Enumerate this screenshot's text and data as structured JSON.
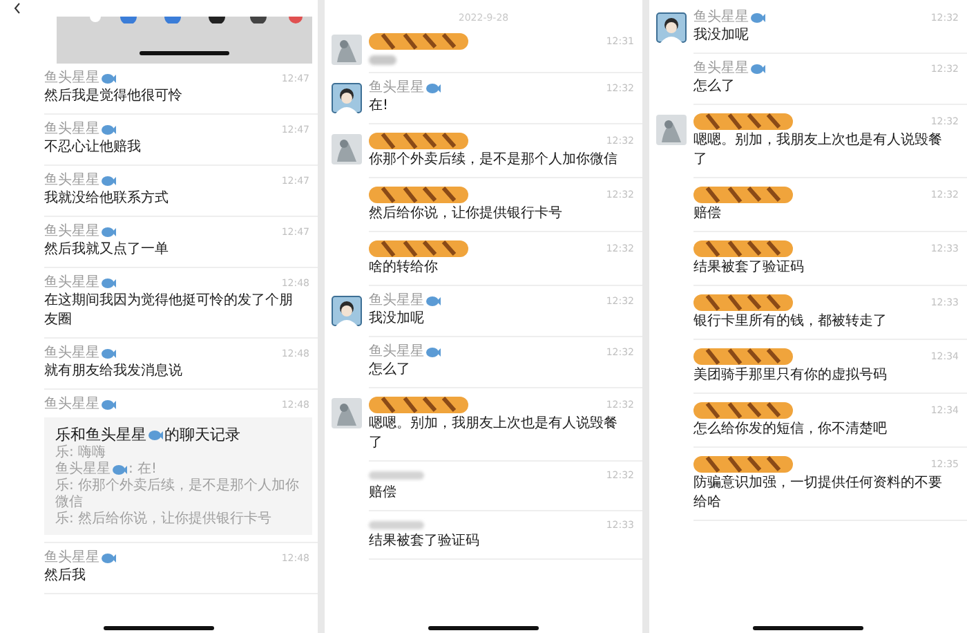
{
  "panels": [
    {
      "header": {
        "kind": "share-strip"
      },
      "messages": [
        {
          "sender": {
            "kind": "name",
            "text": "鱼头星星"
          },
          "time": "12:47",
          "body": {
            "kind": "text",
            "text": "然后我是觉得他很可怜"
          }
        },
        {
          "sender": {
            "kind": "name",
            "text": "鱼头星星"
          },
          "time": "12:47",
          "body": {
            "kind": "text",
            "text": "不忍心让他赔我"
          }
        },
        {
          "sender": {
            "kind": "name",
            "text": "鱼头星星"
          },
          "time": "12:47",
          "body": {
            "kind": "text",
            "text": "我就没给他联系方式"
          }
        },
        {
          "sender": {
            "kind": "name",
            "text": "鱼头星星"
          },
          "time": "12:47",
          "body": {
            "kind": "text",
            "text": "然后我就又点了一单"
          }
        },
        {
          "sender": {
            "kind": "name",
            "text": "鱼头星星"
          },
          "time": "12:48",
          "body": {
            "kind": "text",
            "text": "在这期间我因为觉得他挺可怜的发了个朋友圈"
          }
        },
        {
          "sender": {
            "kind": "name",
            "text": "鱼头星星"
          },
          "time": "12:48",
          "body": {
            "kind": "text",
            "text": "就有朋友给我发消息说"
          }
        },
        {
          "sender": {
            "kind": "name",
            "text": "鱼头星星"
          },
          "time": "12:48",
          "body": {
            "kind": "forward",
            "title_parts": [
              "乐和鱼头星星",
              "的聊天记录"
            ],
            "lines": [
              {
                "parts": [
                  "乐: 嗨嗨"
                ]
              },
              {
                "parts": [
                  "鱼头星星",
                  ": 在!"
                ]
              },
              {
                "parts": [
                  "乐: 你那个外卖后续，是不是那个人加你微信"
                ]
              },
              {
                "parts": [
                  "乐: 然后给你说，让你提供银行卡号"
                ]
              }
            ]
          }
        },
        {
          "sender": {
            "kind": "name",
            "text": "鱼头星星"
          },
          "time": "12:48",
          "body": {
            "kind": "text",
            "text": "然后我"
          }
        }
      ]
    },
    {
      "header": {
        "kind": "date",
        "date": "2022-9-28"
      },
      "messages": [
        {
          "avatar": {
            "kind": "photo"
          },
          "sender": {
            "kind": "redacted"
          },
          "time": "12:31",
          "body": {
            "kind": "blurred"
          }
        },
        {
          "avatar": {
            "kind": "cartoon"
          },
          "sender": {
            "kind": "name",
            "text": "鱼头星星"
          },
          "time": "12:32",
          "body": {
            "kind": "text",
            "text": "在!"
          }
        },
        {
          "avatar": {
            "kind": "photo"
          },
          "sender": {
            "kind": "redacted"
          },
          "time": "12:32",
          "body": {
            "kind": "text",
            "text": "你那个外卖后续，是不是那个人加你微信"
          }
        },
        {
          "sender": {
            "kind": "redacted"
          },
          "time": "12:32",
          "body": {
            "kind": "text",
            "text": "然后给你说，让你提供银行卡号"
          }
        },
        {
          "sender": {
            "kind": "redacted"
          },
          "time": "12:32",
          "body": {
            "kind": "text",
            "text": "啥的转给你"
          }
        },
        {
          "avatar": {
            "kind": "cartoon"
          },
          "sender": {
            "kind": "name",
            "text": "鱼头星星"
          },
          "time": "12:32",
          "body": {
            "kind": "text",
            "text": "我没加呢"
          }
        },
        {
          "sender": {
            "kind": "name",
            "text": "鱼头星星"
          },
          "time": "12:32",
          "body": {
            "kind": "text",
            "text": "怎么了"
          }
        },
        {
          "avatar": {
            "kind": "photo"
          },
          "sender": {
            "kind": "redacted"
          },
          "time": "12:32",
          "body": {
            "kind": "text",
            "text": "嗯嗯。别加，我朋友上次也是有人说毁餐了"
          }
        },
        {
          "sender": {
            "kind": "blurred"
          },
          "time": "12:32",
          "body": {
            "kind": "text",
            "text": "赔偿"
          }
        },
        {
          "sender": {
            "kind": "blurred"
          },
          "time": "12:33",
          "body": {
            "kind": "text",
            "text": "结果被套了验证码"
          }
        }
      ]
    },
    {
      "messages": [
        {
          "avatar": {
            "kind": "cartoon"
          },
          "sender": {
            "kind": "name",
            "text": "鱼头星星"
          },
          "time": "12:32",
          "body": {
            "kind": "text",
            "text": "我没加呢"
          }
        },
        {
          "sender": {
            "kind": "name",
            "text": "鱼头星星"
          },
          "time": "12:32",
          "body": {
            "kind": "text",
            "text": "怎么了"
          }
        },
        {
          "avatar": {
            "kind": "photo"
          },
          "sender": {
            "kind": "redacted"
          },
          "time": "12:32",
          "body": {
            "kind": "text",
            "text": "嗯嗯。别加，我朋友上次也是有人说毁餐了"
          }
        },
        {
          "sender": {
            "kind": "redacted"
          },
          "time": "12:32",
          "body": {
            "kind": "text",
            "text": "赔偿"
          }
        },
        {
          "sender": {
            "kind": "redacted"
          },
          "time": "12:33",
          "body": {
            "kind": "text",
            "text": "结果被套了验证码"
          }
        },
        {
          "sender": {
            "kind": "redacted"
          },
          "time": "12:33",
          "body": {
            "kind": "text",
            "text": "银行卡里所有的钱，都被转走了"
          }
        },
        {
          "sender": {
            "kind": "redacted"
          },
          "time": "12:34",
          "body": {
            "kind": "text",
            "text": "美团骑手那里只有你的虚拟号码"
          }
        },
        {
          "sender": {
            "kind": "redacted"
          },
          "time": "12:34",
          "body": {
            "kind": "text",
            "text": "怎么给你发的短信，你不清楚吧"
          }
        },
        {
          "sender": {
            "kind": "redacted"
          },
          "time": "12:35",
          "body": {
            "kind": "text",
            "text": "防骗意识加强，一切提供任何资料的不要给哈"
          }
        }
      ]
    }
  ]
}
